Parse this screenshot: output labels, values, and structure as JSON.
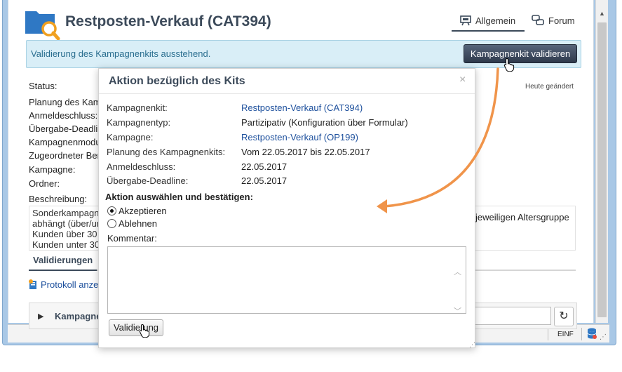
{
  "header": {
    "title": "Restposten-Verkauf (CAT394)",
    "tabs": [
      {
        "label": "Allgemein",
        "icon": "general-icon"
      },
      {
        "label": "Forum",
        "icon": "forum-icon"
      }
    ]
  },
  "banner": {
    "text": "Validierung des Kampagnenkits ausstehend.",
    "button_label": "Kampagnenkit validieren"
  },
  "background_form": {
    "labels": [
      "Status:",
      "Planung des Kamp",
      "Anmeldeschluss:",
      "Übergabe-Deadlin",
      "Kampagnenmodu",
      "Zugeordneter Ber",
      "Kampagne:",
      "Ordner:",
      "Beschreibung:"
    ],
    "changed_note": "Heute geändert",
    "description_lines": [
      "Sonderkampagn",
      "abhängt (über/un",
      "Kunden über 30",
      "Kunden unter 30"
    ],
    "description_right": "jeweiligen Altersgruppe",
    "section_title": "Validierungen",
    "protocol_link": "Protokoll anze",
    "campaign_panel_title": "Kampagne"
  },
  "dialog": {
    "title": "Aktion bezüglich des Kits",
    "close": "×",
    "fields": [
      {
        "label": "Kampagnenkit:",
        "value": "Restposten-Verkauf (CAT394)",
        "link": true
      },
      {
        "label": "Kampagnentyp:",
        "value": "Partizipativ (Konfiguration über Formular)",
        "link": false
      },
      {
        "label": "Kampagne:",
        "value": "Restposten-Verkauf (OP199)",
        "link": true
      },
      {
        "label": "Planung des Kampagnenkits:",
        "value": "Vom 22.05.2017 bis 22.05.2017",
        "link": false
      },
      {
        "label": "Anmeldeschluss:",
        "value": "22.05.2017",
        "link": false
      },
      {
        "label": "Übergabe-Deadline:",
        "value": "22.05.2017",
        "link": false
      }
    ],
    "action_title": "Aktion auswählen und bestätigen:",
    "options": [
      {
        "label": "Akzeptieren",
        "selected": true
      },
      {
        "label": "Ablehnen",
        "selected": false
      }
    ],
    "comment_label": "Kommentar:",
    "comment_value": "",
    "submit_label": "Validierung"
  },
  "statusbar": {
    "mode": "EINF"
  },
  "colors": {
    "accent": "#3c4a5a",
    "link": "#1c4f9c",
    "banner_bg": "#d9eef7",
    "annotation_arrow": "#f0944a"
  }
}
